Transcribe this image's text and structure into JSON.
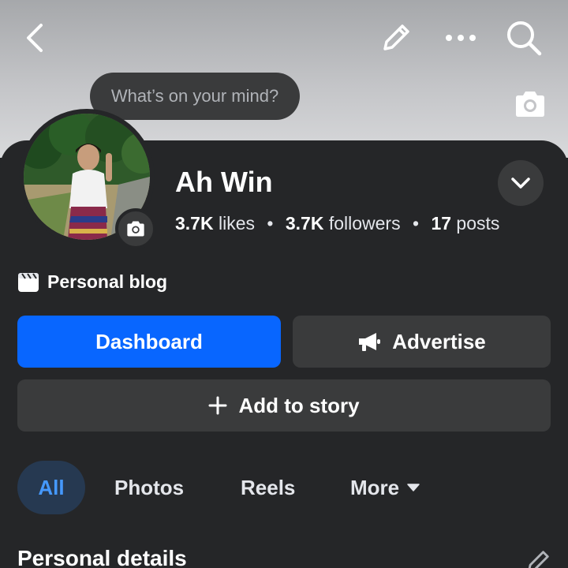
{
  "header": {
    "mind_prompt": "What’s on your mind?"
  },
  "profile": {
    "name": "Ah Win",
    "likes_count": "3.7K",
    "likes_label": "likes",
    "followers_count": "3.7K",
    "followers_label": "followers",
    "posts_count": "17",
    "posts_label": "posts",
    "separator": "•",
    "category": "Personal blog"
  },
  "actions": {
    "dashboard_label": "Dashboard",
    "advertise_label": "Advertise",
    "story_label": "Add to story"
  },
  "tabs": [
    {
      "label": "All",
      "active": true
    },
    {
      "label": "Photos",
      "active": false
    },
    {
      "label": "Reels",
      "active": false
    },
    {
      "label": "More",
      "active": false
    }
  ],
  "section": {
    "title": "Personal details"
  },
  "icons": {
    "back": "back-arrow-icon",
    "edit": "pencil-icon",
    "more": "more-dots-icon",
    "search": "search-icon",
    "cover_camera": "camera-icon",
    "avatar_camera": "camera-icon",
    "expand": "chevron-down-icon",
    "category": "blog-page-icon",
    "advertise": "megaphone-icon",
    "add": "plus-icon",
    "more_caret": "caret-down-icon"
  },
  "colors": {
    "primary_button": "#0866ff",
    "active_tab_bg": "#263951",
    "active_tab_text": "#4599ff",
    "surface": "#252628",
    "secondary_button": "#3a3b3c"
  }
}
